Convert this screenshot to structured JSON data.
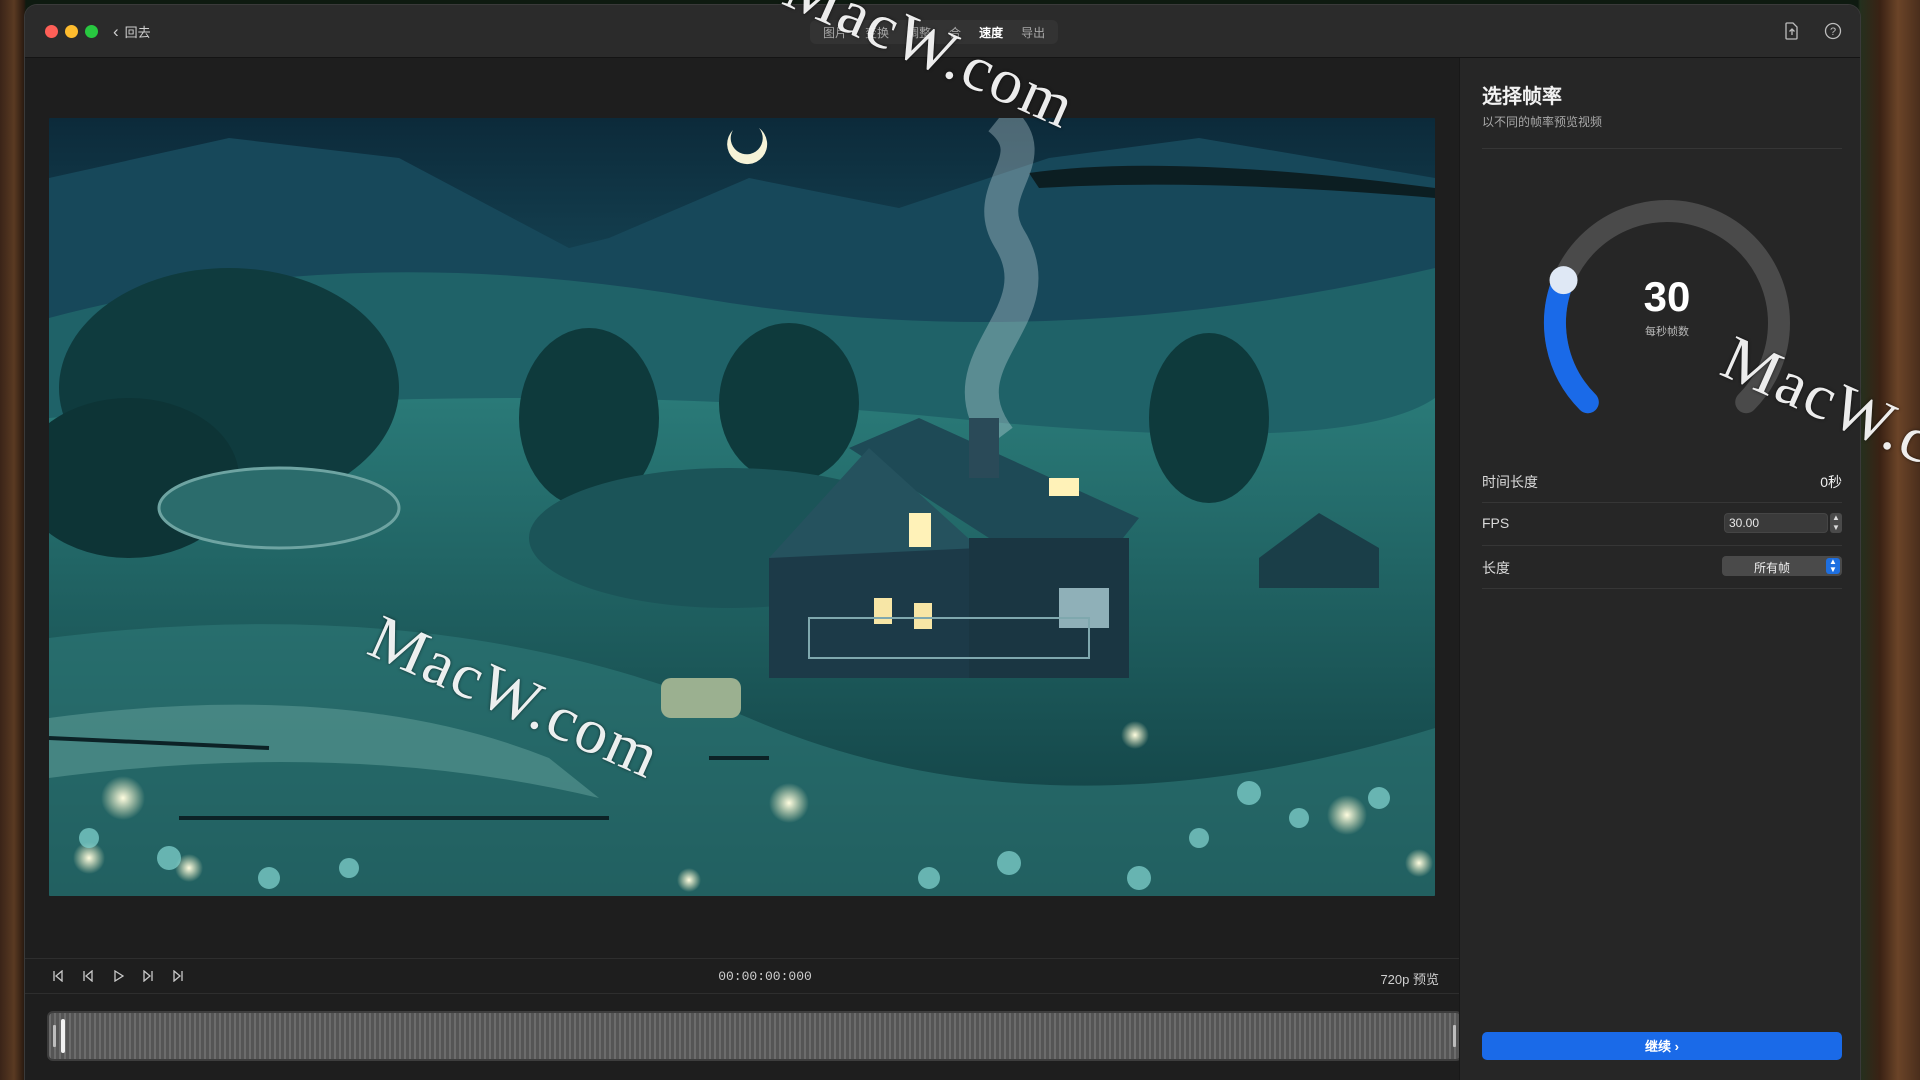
{
  "window": {
    "back_label": "回去",
    "tabs": [
      {
        "label": "图片",
        "active": false
      },
      {
        "label": "变换",
        "active": false
      },
      {
        "label": "调整",
        "active": false
      },
      {
        "label": "合",
        "active": false
      },
      {
        "label": "速度",
        "active": true
      },
      {
        "label": "导出",
        "active": false
      }
    ],
    "icons": {
      "share": "share-document-icon",
      "help": "help-icon"
    }
  },
  "player": {
    "timecode": "00:00:00:000",
    "quality": "720p 预览",
    "controls": [
      "skip-to-start-icon",
      "step-back-icon",
      "play-icon",
      "step-forward-icon",
      "skip-to-end-icon"
    ],
    "playhead_fraction": 0.0
  },
  "panel": {
    "title": "选择帧率",
    "subtitle": "以不同的帧率预览视频",
    "dial": {
      "value": "30",
      "unit": "每秒帧数",
      "min": 0,
      "max": 120,
      "fraction": 0.25
    },
    "duration": {
      "label": "时间长度",
      "value": "0秒"
    },
    "fps": {
      "label": "FPS",
      "value": "30.00"
    },
    "length": {
      "label": "长度",
      "selected": "所有帧"
    },
    "continue_label": "继续 ›"
  },
  "watermarks": [
    "MacW.com",
    "MacW.com",
    "MacW.co"
  ],
  "colors": {
    "accent": "#1a6ae8",
    "dial_track": "#4a4a4a",
    "dial_fill": "#1a6ae8"
  }
}
